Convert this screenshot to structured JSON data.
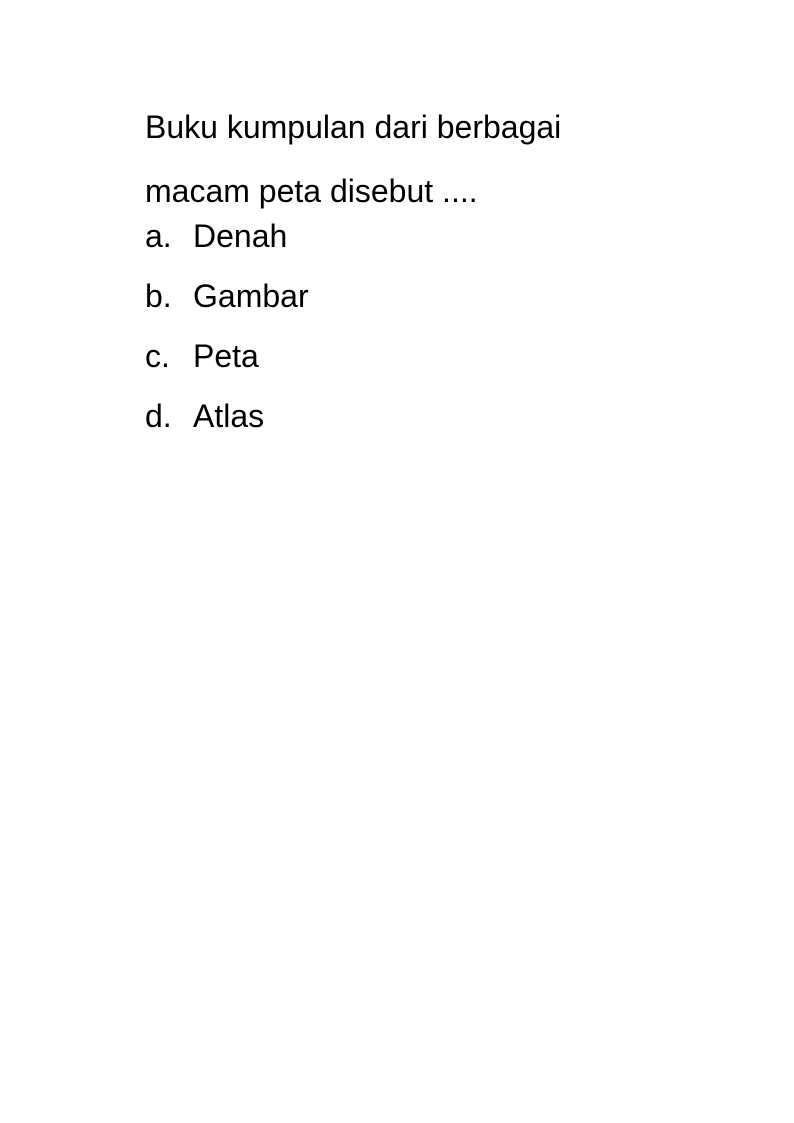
{
  "question": {
    "line1": "Buku kumpulan dari berbagai",
    "line2": "macam peta disebut ...."
  },
  "options": [
    {
      "letter": "a.",
      "text": "Denah"
    },
    {
      "letter": "b.",
      "text": "Gambar"
    },
    {
      "letter": "c.",
      "text": "Peta"
    },
    {
      "letter": "d.",
      "text": "Atlas"
    }
  ]
}
